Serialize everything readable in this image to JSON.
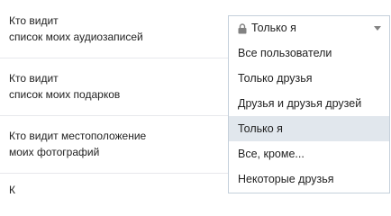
{
  "rows": [
    {
      "line1": "Кто видит",
      "line2": "список моих аудиозаписей"
    },
    {
      "line1": "Кто видит",
      "line2": "список моих подарков"
    },
    {
      "line1": "Кто видит местоположение",
      "line2": "моих фотографий"
    },
    {
      "line1": "К"
    }
  ],
  "select": {
    "value": "Только я",
    "lock_icon": "lock-icon",
    "arrow_icon": "chevron-down-icon"
  },
  "dropdown": {
    "options": [
      {
        "label": "Все пользователи"
      },
      {
        "label": "Только друзья"
      },
      {
        "label": "Друзья и друзья друзей"
      },
      {
        "label": "Только я",
        "selected": true
      },
      {
        "label": "Все, кроме..."
      },
      {
        "label": "Некоторые друзья"
      }
    ]
  },
  "colors": {
    "border": "#c5d0db",
    "selected_bg": "#e1e7ed",
    "divider": "#e7e8ec",
    "icon": "#828282"
  }
}
